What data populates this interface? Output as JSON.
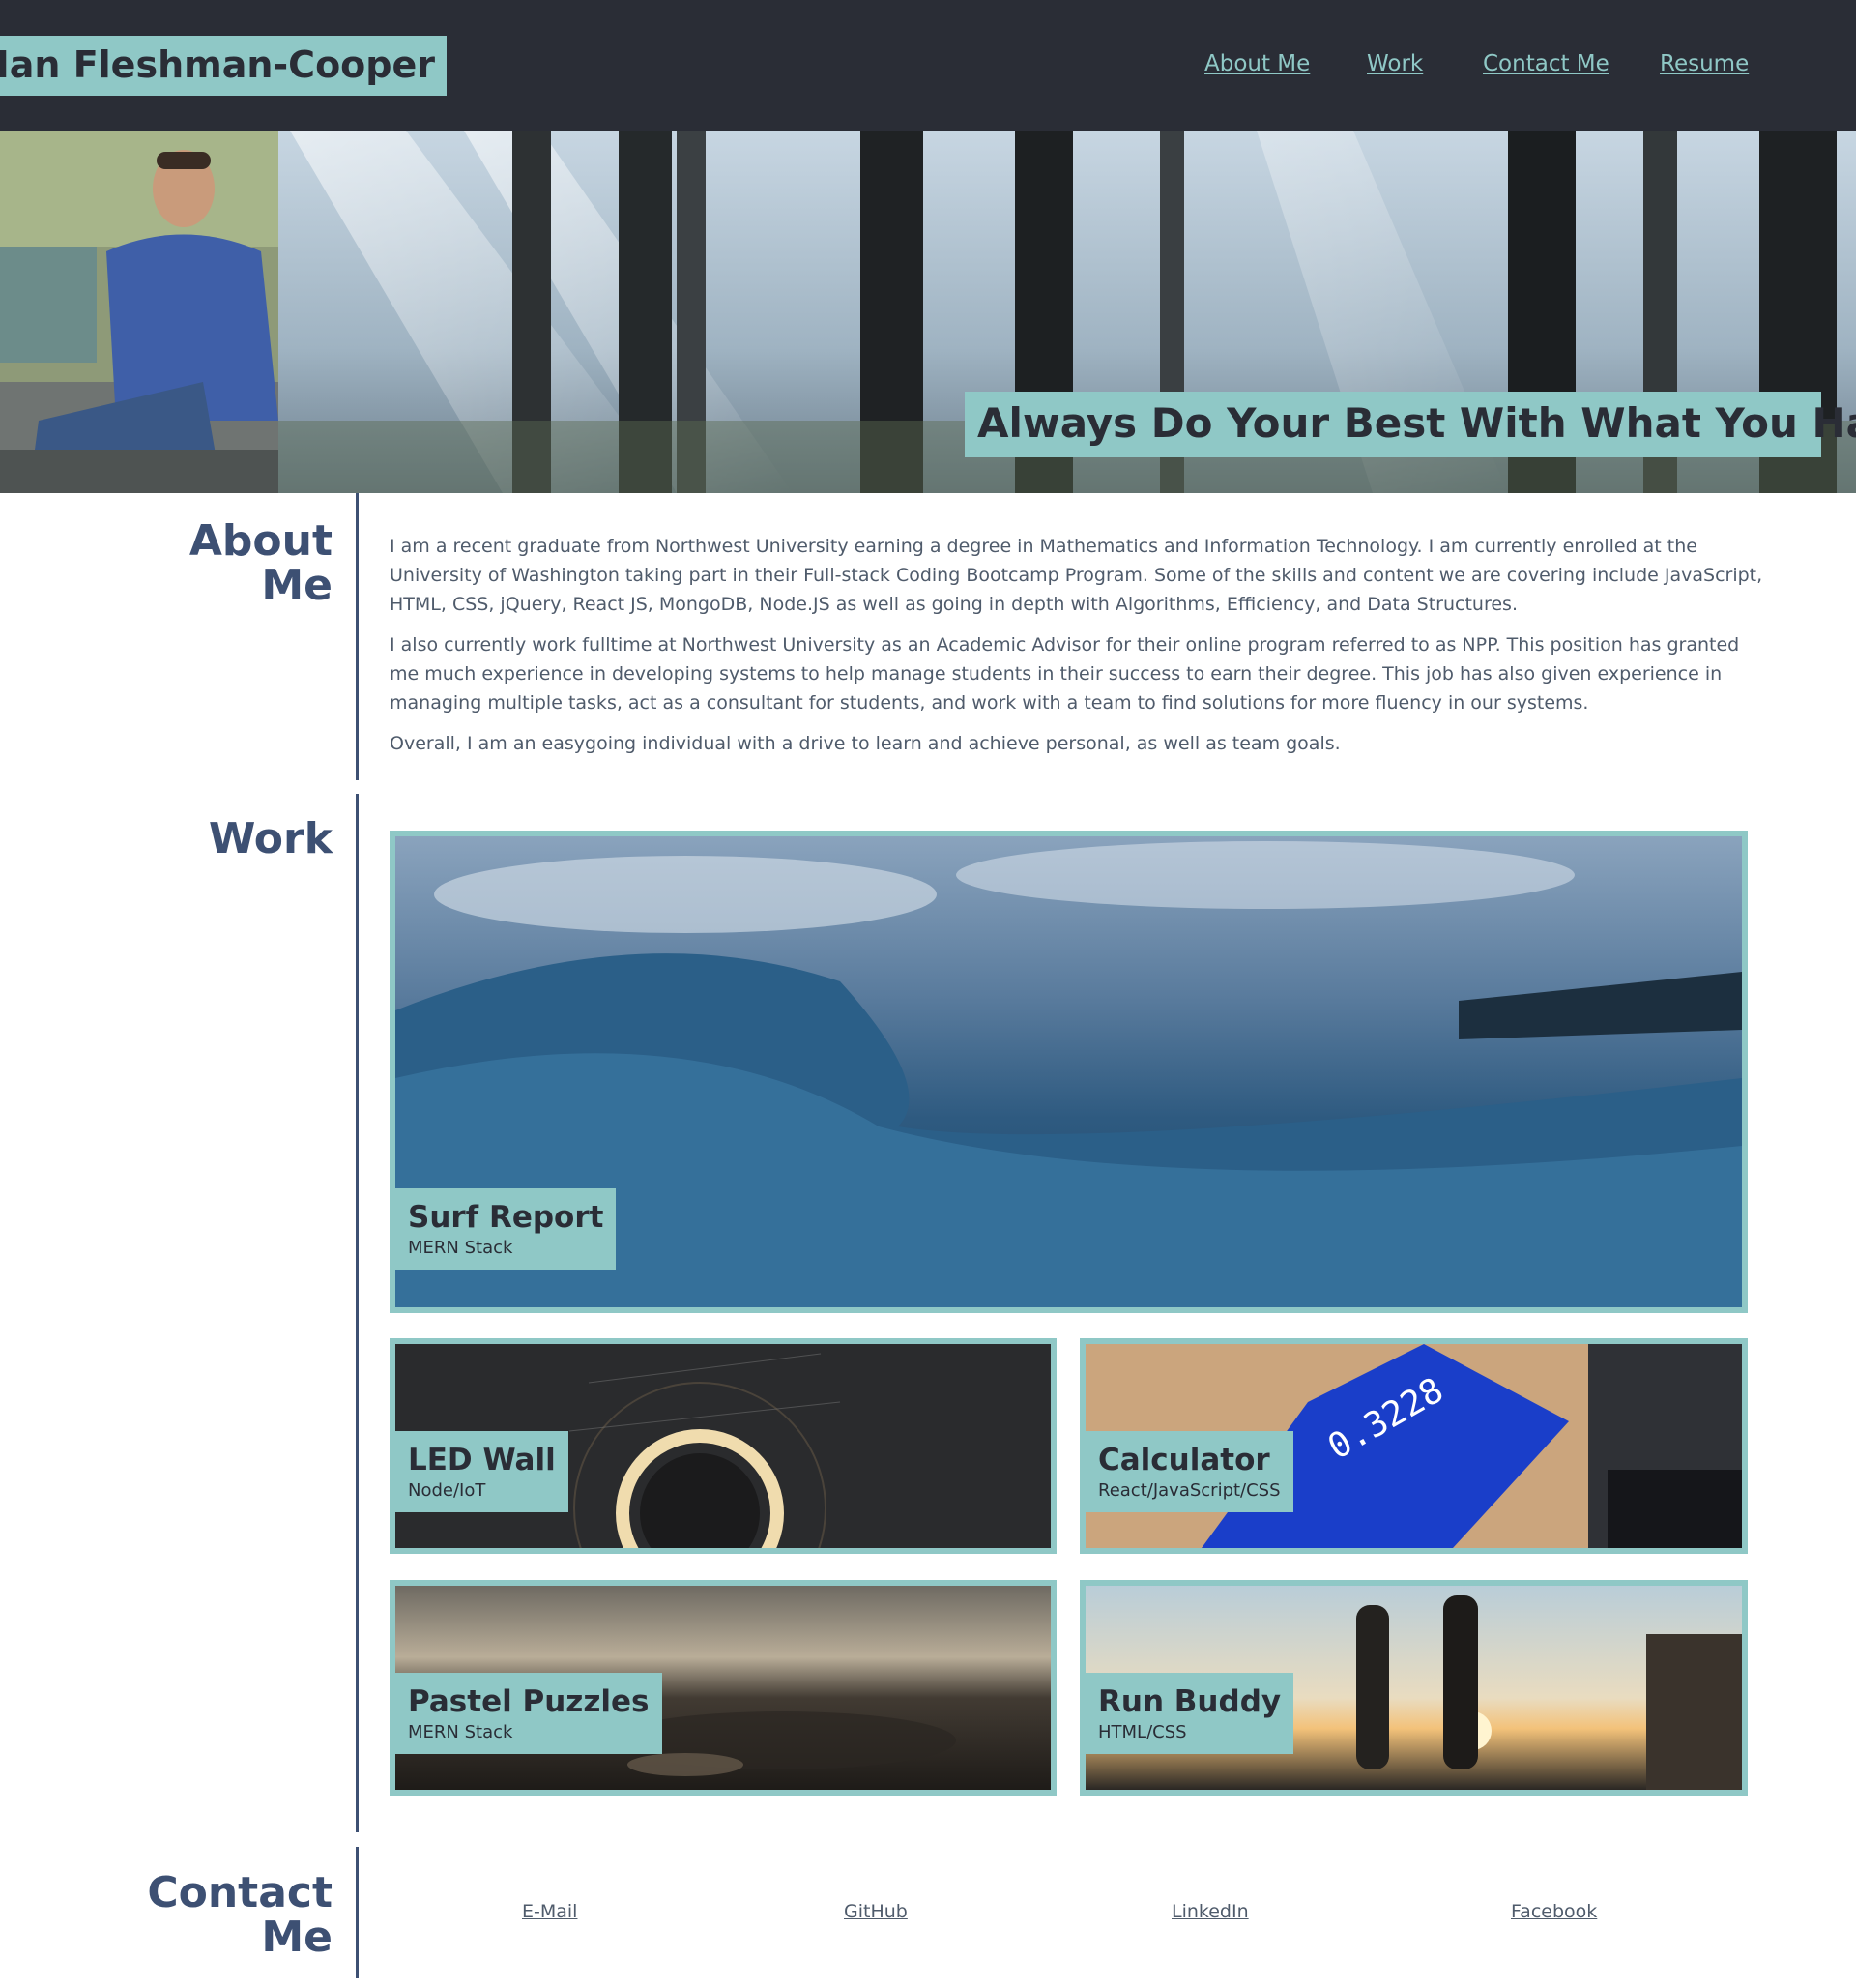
{
  "header": {
    "name": "Ian Fleshman-Cooper",
    "nav": [
      {
        "label": "About Me"
      },
      {
        "label": "Work"
      },
      {
        "label": "Contact Me"
      },
      {
        "label": "Resume"
      }
    ]
  },
  "hero": {
    "tagline": "Always Do Your Best With What You Have"
  },
  "about": {
    "title_line1": "About",
    "title_line2": "Me",
    "paragraphs": [
      "I am a recent graduate from Northwest University earning a degree in Mathematics and Information Technology. I am currently enrolled at the University of Washington taking part in their Full-stack Coding Bootcamp Program. Some of the skills and content we are covering include JavaScript, HTML, CSS, jQuery, React JS, MongoDB, Node.JS as well as going in depth with Algorithms, Efficiency, and Data Structures.",
      "I also currently work fulltime at Northwest University as an Academic Advisor for their online program referred to as NPP. This position has granted me much experience in developing systems to help manage students in their success to earn their degree. This job has also given experience in managing multiple tasks, act as a consultant for students, and work with a team to find solutions for more fluency in our systems.",
      "Overall, I am an easygoing individual with a drive to learn and achieve personal, as well as team goals."
    ]
  },
  "work": {
    "title": "Work",
    "projects": [
      {
        "title": "Surf Report",
        "stack": "MERN Stack"
      },
      {
        "title": "LED Wall",
        "stack": "Node/IoT"
      },
      {
        "title": "Calculator",
        "stack": "React/JavaScript/CSS"
      },
      {
        "title": "Pastel Puzzles",
        "stack": "MERN Stack"
      },
      {
        "title": "Run Buddy",
        "stack": "HTML/CSS"
      }
    ]
  },
  "contact": {
    "title_line1": "Contact",
    "title_line2": "Me",
    "links": [
      {
        "label": "E-Mail"
      },
      {
        "label": "GitHub"
      },
      {
        "label": "LinkedIn"
      },
      {
        "label": "Facebook"
      }
    ]
  },
  "colors": {
    "header_bg": "#2a2d36",
    "accent_teal": "#8fc8c6",
    "heading_blue": "#3d5073",
    "body_text": "#4f5b6b"
  }
}
